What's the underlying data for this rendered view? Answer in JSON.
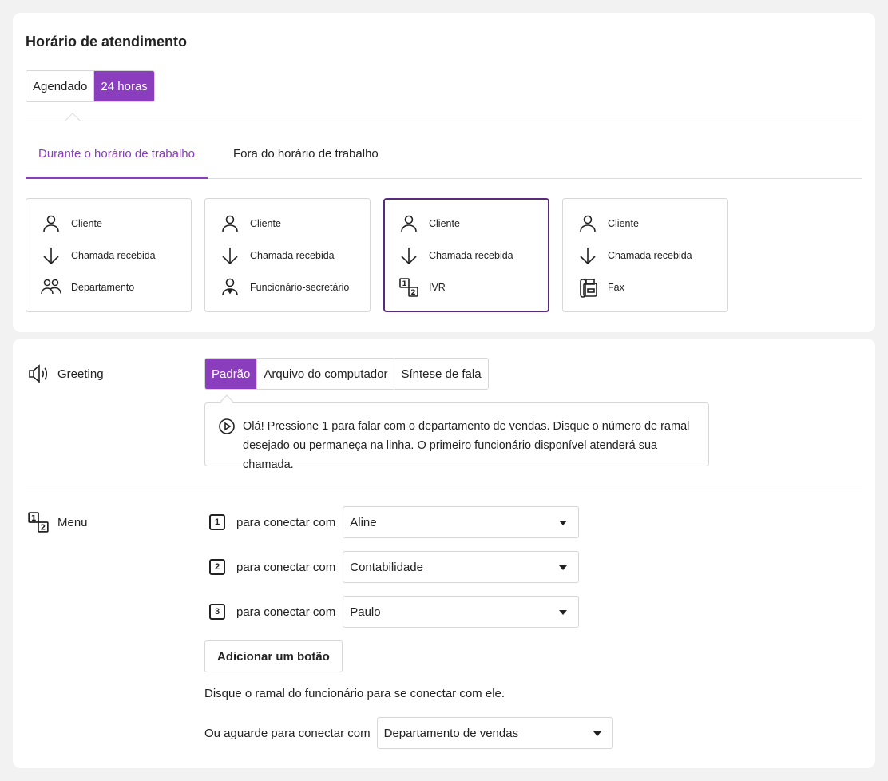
{
  "schedule": {
    "title": "Horário de atendimento",
    "modes": [
      {
        "label": "Agendado",
        "active": false
      },
      {
        "label": "24 horas",
        "active": true
      }
    ],
    "tabs": [
      {
        "label": "Durante o horário de trabalho",
        "active": true
      },
      {
        "label": "Fora do horário de trabalho",
        "active": false
      }
    ],
    "flows": [
      {
        "steps": [
          "Cliente",
          "Chamada recebida",
          "Departamento"
        ],
        "icons": [
          "person-icon",
          "arrow-down-icon",
          "group-icon"
        ],
        "selected": false
      },
      {
        "steps": [
          "Cliente",
          "Chamada recebida",
          "Funcionário-secretário"
        ],
        "icons": [
          "person-icon",
          "arrow-down-icon",
          "secretary-icon"
        ],
        "selected": false
      },
      {
        "steps": [
          "Cliente",
          "Chamada recebida",
          "IVR"
        ],
        "icons": [
          "person-icon",
          "arrow-down-icon",
          "ivr-icon"
        ],
        "selected": true
      },
      {
        "steps": [
          "Cliente",
          "Chamada recebida",
          "Fax"
        ],
        "icons": [
          "person-icon",
          "arrow-down-icon",
          "fax-icon"
        ],
        "selected": false
      }
    ]
  },
  "greeting": {
    "label": "Greeting",
    "options": [
      {
        "label": "Padrão",
        "active": true
      },
      {
        "label": "Arquivo do computador",
        "active": false
      },
      {
        "label": "Síntese de fala",
        "active": false
      }
    ],
    "message": "Olá! Pressione 1 para falar com o departamento de vendas. Disque o número de ramal desejado ou permaneça na linha. O primeiro funcionário disponível atenderá sua chamada."
  },
  "menu": {
    "label": "Menu",
    "connect_label": "para conectar com",
    "items": [
      {
        "key": "1",
        "target": "Aline"
      },
      {
        "key": "2",
        "target": "Contabilidade"
      },
      {
        "key": "3",
        "target": "Paulo"
      }
    ],
    "add_button": "Adicionar um botão",
    "hint": "Disque o ramal do funcionário para se conectar com ele.",
    "wait_label": "Ou aguarde para conectar com",
    "wait_target": "Departamento de vendas"
  },
  "colors": {
    "accent": "#8a3dbd",
    "selected_border": "#5a2a7f"
  }
}
